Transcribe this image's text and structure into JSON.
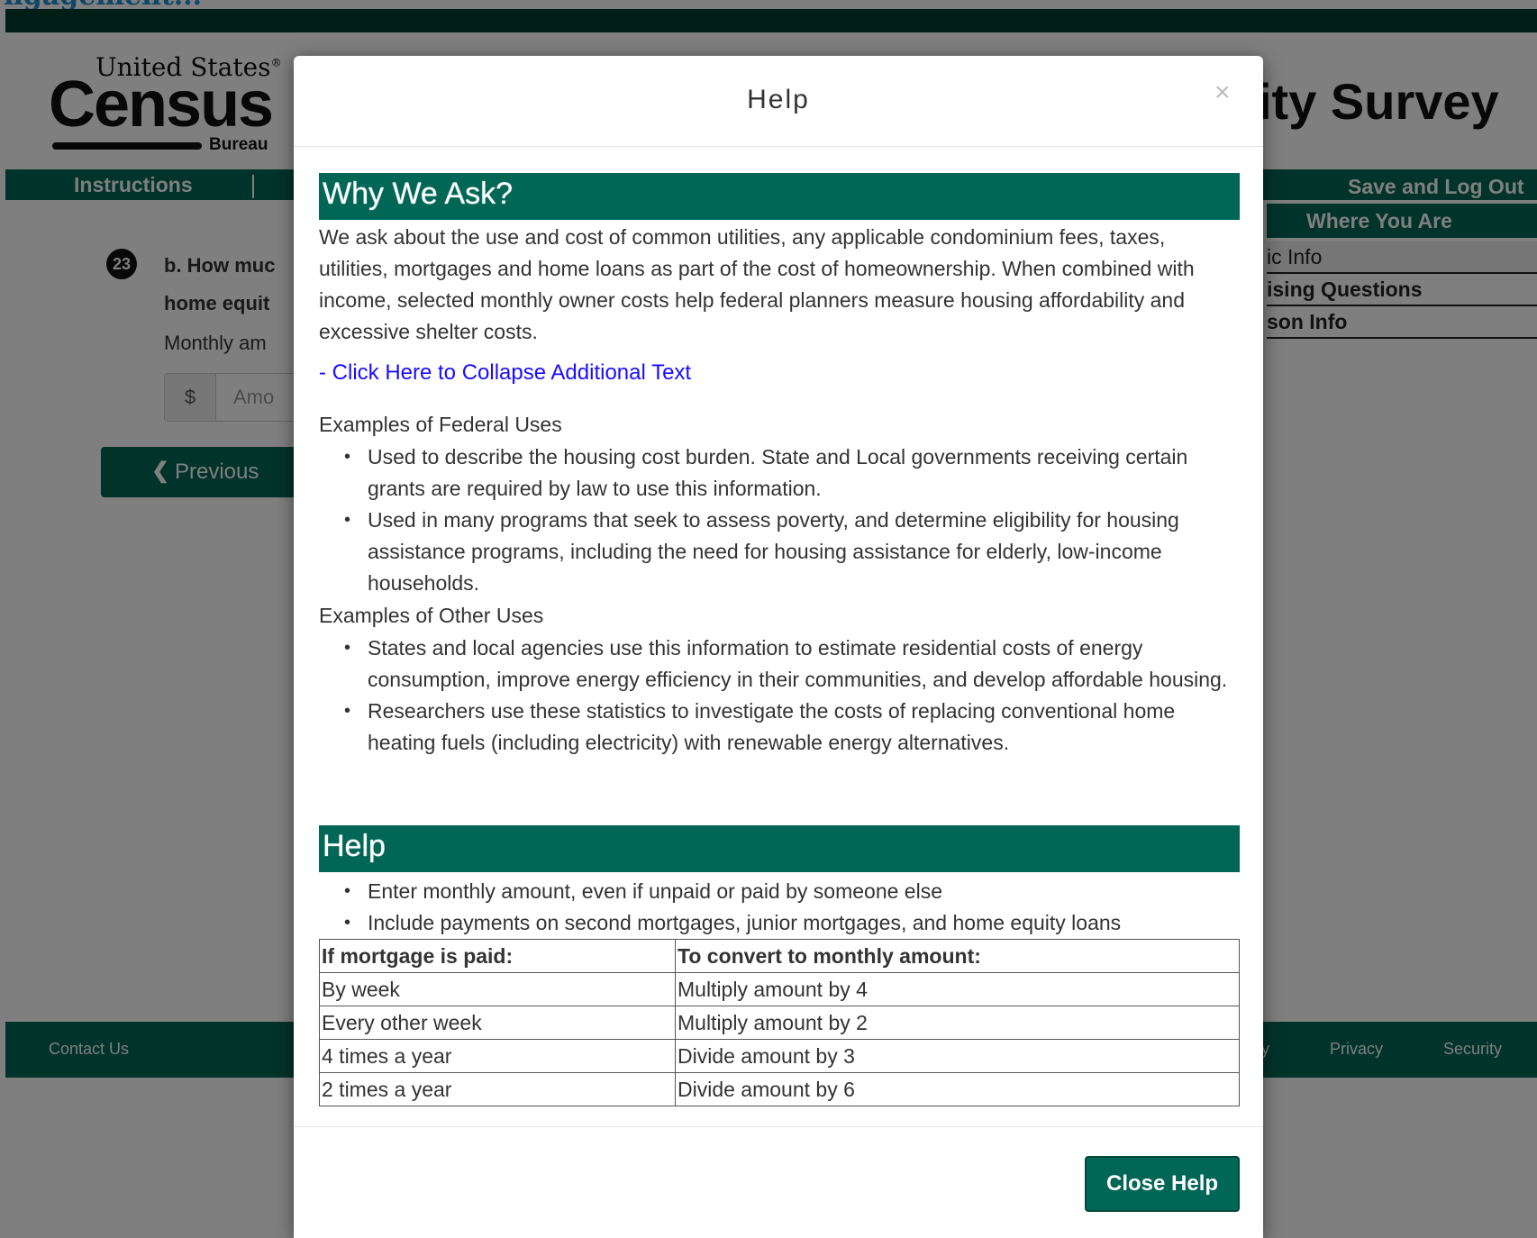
{
  "page": {
    "top_heading": "ngagement...",
    "logo": {
      "line1": "United States",
      "registered": "®",
      "line2": "Census",
      "line3": "Bureau"
    },
    "survey_title": "ity Survey",
    "nav": {
      "instructions": "Instructions",
      "save_logout": "Save and Log Out"
    },
    "where_you_are": {
      "title": "Where You Are",
      "items": [
        "ic Info",
        "ising Questions",
        "son Info"
      ]
    },
    "question": {
      "number": "23",
      "text_line1": "b. How muc",
      "text_line2": "home equit"
    },
    "amount": {
      "label": "Monthly am",
      "currency": "$",
      "placeholder": "Amo"
    },
    "previous_button": {
      "icon": "❮",
      "label": "Previous"
    },
    "footer": {
      "contact": "Contact Us",
      "partial": "y",
      "privacy": "Privacy",
      "security": "Security"
    }
  },
  "modal": {
    "title": "Help",
    "close_glyph": "×",
    "why_heading": "Why We Ask?",
    "intro": "We ask about the use and cost of common utilities, any applicable condominium fees, taxes, utilities, mortgages and home loans as part of the cost of homeownership. When combined with income, selected monthly owner costs help federal planners measure housing affordability and excessive shelter costs.",
    "collapse_link": "- Click Here to Collapse Additional Text",
    "federal_heading": "Examples of Federal Uses",
    "federal_uses": [
      "Used to describe the housing cost burden. State and Local governments receiving certain grants are required by law to use this information.",
      "Used in many programs that seek to assess poverty, and determine eligibility for housing assistance programs, including the need for housing assistance for elderly, low-income households."
    ],
    "other_heading": "Examples of Other Uses",
    "other_uses": [
      "States and local agencies use this information to estimate residential costs of energy consumption, improve energy efficiency in their communities, and develop affordable housing.",
      "Researchers use these statistics to investigate the costs of replacing conventional home heating fuels (including electricity) with renewable energy alternatives."
    ],
    "help_heading": "Help",
    "help_items": [
      "Enter monthly amount, even if unpaid or paid by someone else",
      "Include payments on second mortgages, junior mortgages, and home equity loans"
    ],
    "table": {
      "headers": [
        "If mortgage is paid:",
        "To convert to monthly amount:"
      ],
      "rows": [
        [
          "By week",
          "Multiply amount by 4"
        ],
        [
          "Every other week",
          "Multiply amount by 2"
        ],
        [
          "4 times a year",
          "Divide amount by 3"
        ],
        [
          "2 times a year",
          "Divide amount by 6"
        ]
      ]
    },
    "close_button": "Close Help"
  },
  "colors": {
    "brand_green": "#006655",
    "dark_green": "#003a2d",
    "link_blue": "#1a0dff"
  }
}
